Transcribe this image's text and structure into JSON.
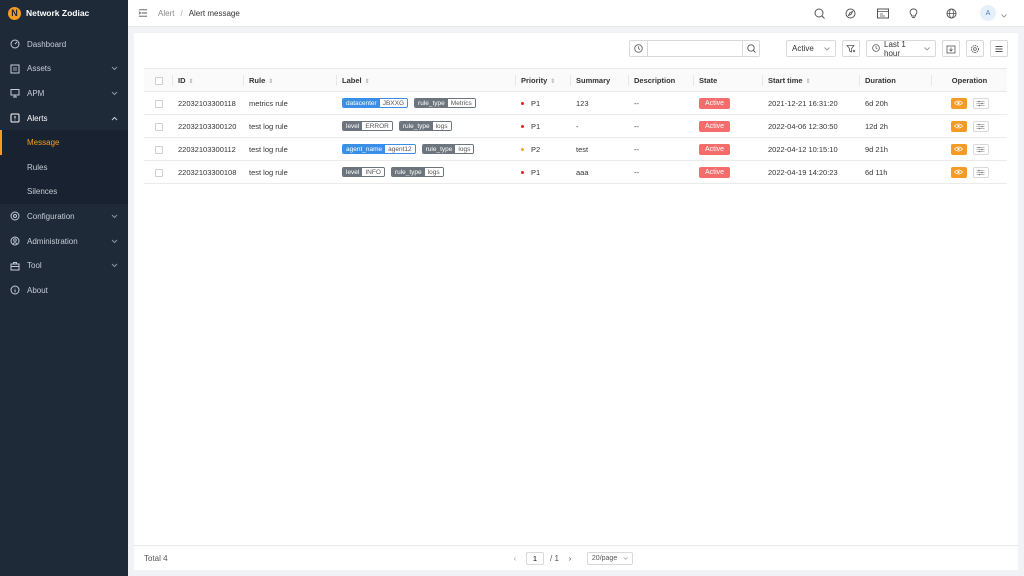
{
  "brand": {
    "name": "Network Zodiac",
    "logo_letter": "N"
  },
  "sidebar": {
    "items": [
      {
        "label": "Dashboard",
        "icon": "dashboard-icon",
        "has_children": false
      },
      {
        "label": "Assets",
        "icon": "list-icon",
        "has_children": true
      },
      {
        "label": "APM",
        "icon": "monitor-icon",
        "has_children": true
      },
      {
        "label": "Alerts",
        "icon": "alert-icon",
        "has_children": true,
        "open": true,
        "children": [
          {
            "label": "Message",
            "active": true
          },
          {
            "label": "Rules",
            "active": false
          },
          {
            "label": "Silences",
            "active": false
          }
        ]
      },
      {
        "label": "Configuration",
        "icon": "gear-icon",
        "has_children": true
      },
      {
        "label": "Administration",
        "icon": "user-icon",
        "has_children": true
      },
      {
        "label": "Tool",
        "icon": "toolbox-icon",
        "has_children": true
      },
      {
        "label": "About",
        "icon": "info-icon",
        "has_children": false
      }
    ]
  },
  "topbar": {
    "breadcrumb": {
      "parent": "Alert",
      "separator": "/",
      "current": "Alert message"
    },
    "avatar_letter": "A"
  },
  "toolbar": {
    "search_value": "",
    "state_filter": "Active",
    "time_range": "Last 1 hour"
  },
  "table": {
    "columns": {
      "id": "ID",
      "rule": "Rule",
      "label": "Label",
      "priority": "Priority",
      "summary": "Summary",
      "description": "Description",
      "state": "State",
      "start_time": "Start time",
      "duration": "Duration",
      "operation": "Operation"
    },
    "rows": [
      {
        "id": "22032103300118",
        "rule": "metrics rule",
        "labels": [
          {
            "key": "datacenter",
            "value": "JBXXG",
            "style": "blue"
          },
          {
            "key": "rule_type",
            "value": "Metrics",
            "style": "gray"
          }
        ],
        "priority": "P1",
        "priority_color": "#e02020",
        "summary": "123",
        "description": "--",
        "state": "Active",
        "start_time": "2021-12-21 16:31:20",
        "duration": "6d 20h"
      },
      {
        "id": "22032103300120",
        "rule": "test log rule",
        "labels": [
          {
            "key": "level",
            "value": "ERROR",
            "style": "gray"
          },
          {
            "key": "rule_type",
            "value": "logs",
            "style": "gray"
          }
        ],
        "priority": "P1",
        "priority_color": "#e02020",
        "summary": "-",
        "description": "--",
        "state": "Active",
        "start_time": "2022-04-06 12:30:50",
        "duration": "12d 2h"
      },
      {
        "id": "22032103300112",
        "rule": "test log rule",
        "labels": [
          {
            "key": "agent_name",
            "value": "agent12",
            "style": "blue"
          },
          {
            "key": "rule_type",
            "value": "logs",
            "style": "gray"
          }
        ],
        "priority": "P2",
        "priority_color": "#f5a623",
        "summary": "test",
        "description": "--",
        "state": "Active",
        "start_time": "2022-04-12 10:15:10",
        "duration": "9d 21h"
      },
      {
        "id": "22032103300108",
        "rule": "test log rule",
        "labels": [
          {
            "key": "level",
            "value": "INFO",
            "style": "gray"
          },
          {
            "key": "rule_type",
            "value": "logs",
            "style": "gray"
          }
        ],
        "priority": "P1",
        "priority_color": "#e02020",
        "summary": "aaa",
        "description": "--",
        "state": "Active",
        "start_time": "2022-04-19 14:20:23",
        "duration": "6d 11h"
      }
    ]
  },
  "footer": {
    "total_label": "Total 4",
    "current_page": "1",
    "total_pages": "/ 1",
    "page_size": "20/page"
  },
  "colors": {
    "accent": "#f59a23",
    "sidebar_bg": "#1f2a38",
    "state_active": "#f56c6c",
    "label_blue": "#3a8ee6"
  }
}
